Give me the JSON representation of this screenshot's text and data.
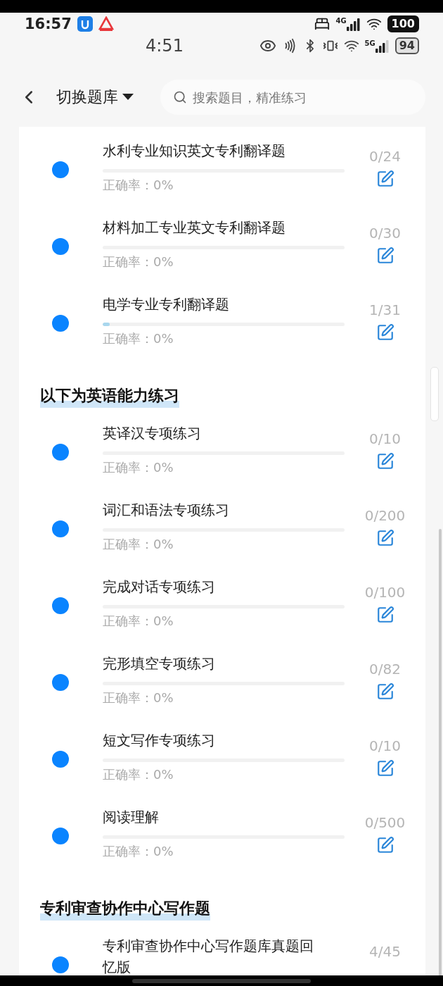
{
  "status_bar": {
    "time": "16:57",
    "network": "4G",
    "battery": "100"
  },
  "status_bar_2": {
    "time": "4:51",
    "network": "5G",
    "battery": "94"
  },
  "header": {
    "title": "切换题库",
    "search": {
      "placeholder": "搜索题目，精准练习"
    }
  },
  "sections": [
    {
      "items": [
        {
          "title": "水利专业知识英文专利翻译题",
          "level": 0,
          "accuracy": "正确率：0%",
          "count": "0/24"
        },
        {
          "title": "材料加工专业英文专利翻译题",
          "level": 0,
          "accuracy": "正确率：0%",
          "count": "0/30"
        },
        {
          "title": "电学专业专利翻译题",
          "level": 0.03,
          "accuracy": "正确率：0%",
          "count": "1/31"
        }
      ]
    },
    {
      "heading": "以下为英语能力练习",
      "items": [
        {
          "title": "英译汉专项练习",
          "level": 0,
          "accuracy": "正确率：0%",
          "count": "0/10"
        },
        {
          "title": "词汇和语法专项练习",
          "level": 0,
          "accuracy": "正确率：0%",
          "count": "0/200"
        },
        {
          "title": "完成对话专项练习",
          "level": 0,
          "accuracy": "正确率：0%",
          "count": "0/100"
        },
        {
          "title": "完形填空专项练习",
          "level": 0,
          "accuracy": "正确率：0%",
          "count": "0/82"
        },
        {
          "title": "短文写作专项练习",
          "level": 0,
          "accuracy": "正确率：0%",
          "count": "0/10"
        },
        {
          "title": "阅读理解",
          "level": 0,
          "accuracy": "正确率：0%",
          "count": "0/500"
        }
      ]
    },
    {
      "heading": "专利审查协作中心写作题",
      "items": [
        {
          "title": "专利审查协作中心写作题库真题回忆版",
          "count": "4/45"
        }
      ]
    }
  ]
}
